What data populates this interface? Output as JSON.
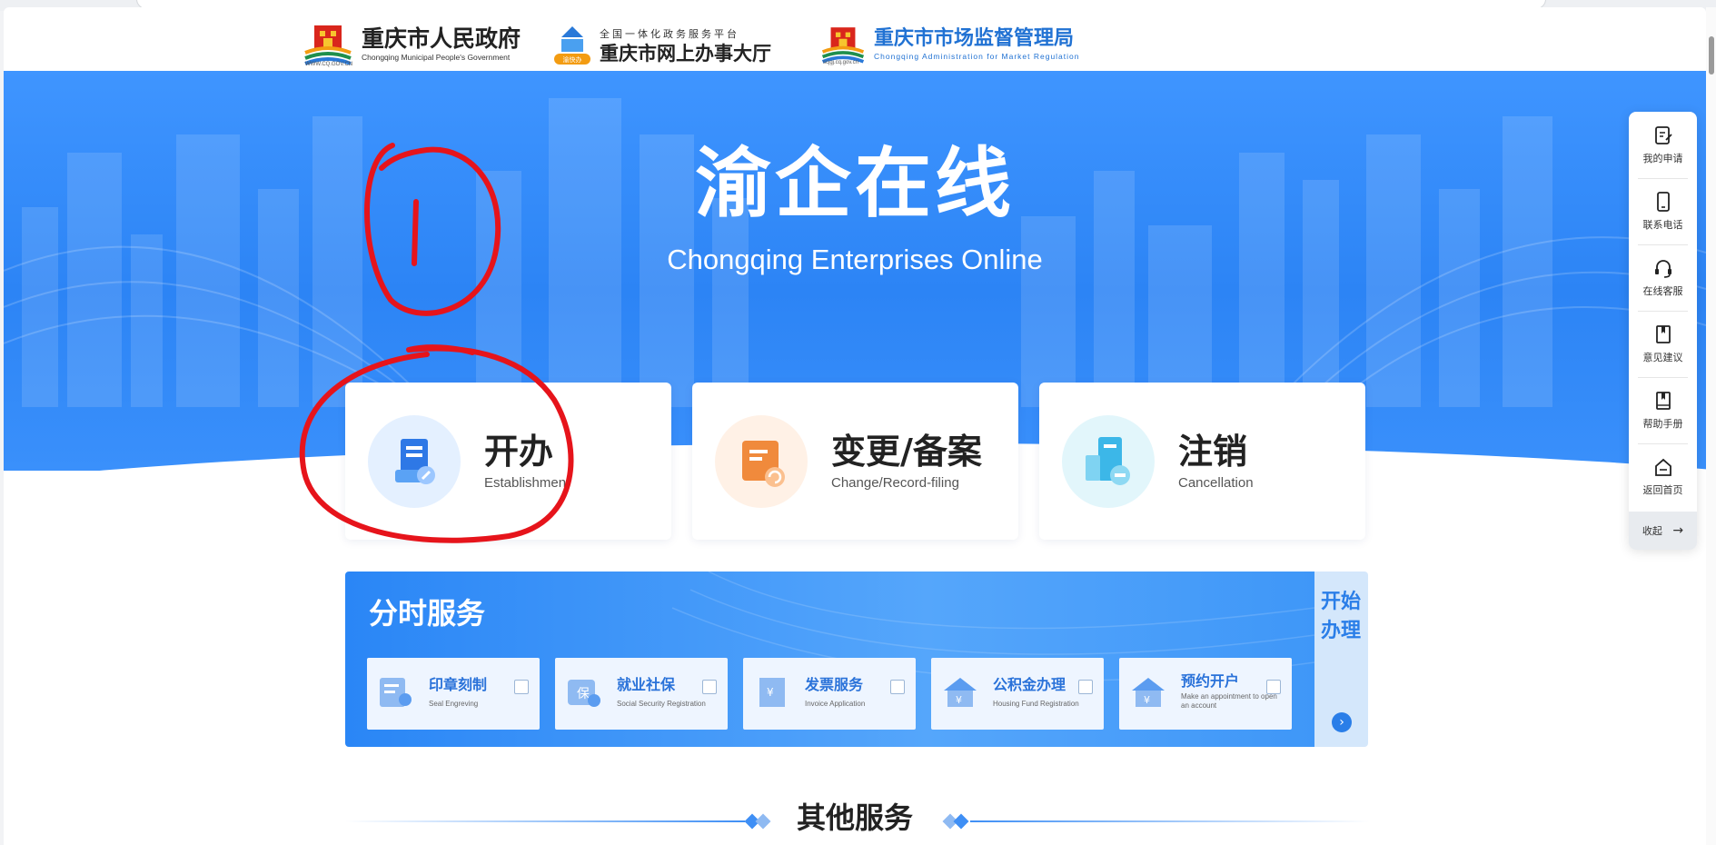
{
  "header": {
    "gov_logo": {
      "title": "重庆市人民政府",
      "subtitle": "Chongqing Municipal People's Government",
      "url": "WWW.CQ.GOV.CN"
    },
    "hall_logo": {
      "top": "全国一体化政务服务平台",
      "title": "重庆市网上办事大厅",
      "badge": "渝快办"
    },
    "market_logo": {
      "title": "重庆市市场监督管理局",
      "subtitle": "Chongqing  Administration for Market Regulation",
      "url": "scjgj.cq.gov.cn"
    }
  },
  "banner": {
    "title": "渝企在线",
    "subtitle": "Chongqing Enterprises Online"
  },
  "cards": [
    {
      "title": "开办",
      "en": "Establishment",
      "icon": "establishment-doc-icon"
    },
    {
      "title": "变更/备案",
      "en": "Change/Record-filing",
      "icon": "change-doc-icon"
    },
    {
      "title": "注销",
      "en": "Cancellation",
      "icon": "cancellation-building-icon"
    }
  ],
  "timeshare": {
    "title": "分时服务",
    "start": "开始办理",
    "items": [
      {
        "label": "印章刻制",
        "en": "Seal Engreving",
        "icon": "seal-icon"
      },
      {
        "label": "就业社保",
        "en": "Social Security Registration",
        "icon": "social-security-icon"
      },
      {
        "label": "发票服务",
        "en": "Invoice Application",
        "icon": "invoice-icon"
      },
      {
        "label": "公积金办理",
        "en": "Housing Fund Registration",
        "icon": "housing-fund-icon"
      },
      {
        "label": "预约开户",
        "en": "Make an appointment to open an account",
        "icon": "bank-account-icon"
      }
    ]
  },
  "other": {
    "title": "其他服务"
  },
  "toolbar": {
    "items": [
      {
        "label": "我的申请",
        "icon": "edit-icon"
      },
      {
        "label": "联系电话",
        "icon": "phone-icon"
      },
      {
        "label": "在线客服",
        "icon": "headset-icon"
      },
      {
        "label": "意见建议",
        "icon": "book-icon"
      },
      {
        "label": "帮助手册",
        "icon": "manual-icon"
      },
      {
        "label": "返回首页",
        "icon": "home-icon"
      }
    ],
    "collapse": "收起"
  },
  "colors": {
    "brand_blue": "#2c84f5",
    "annotation_red": "#e6141b"
  }
}
